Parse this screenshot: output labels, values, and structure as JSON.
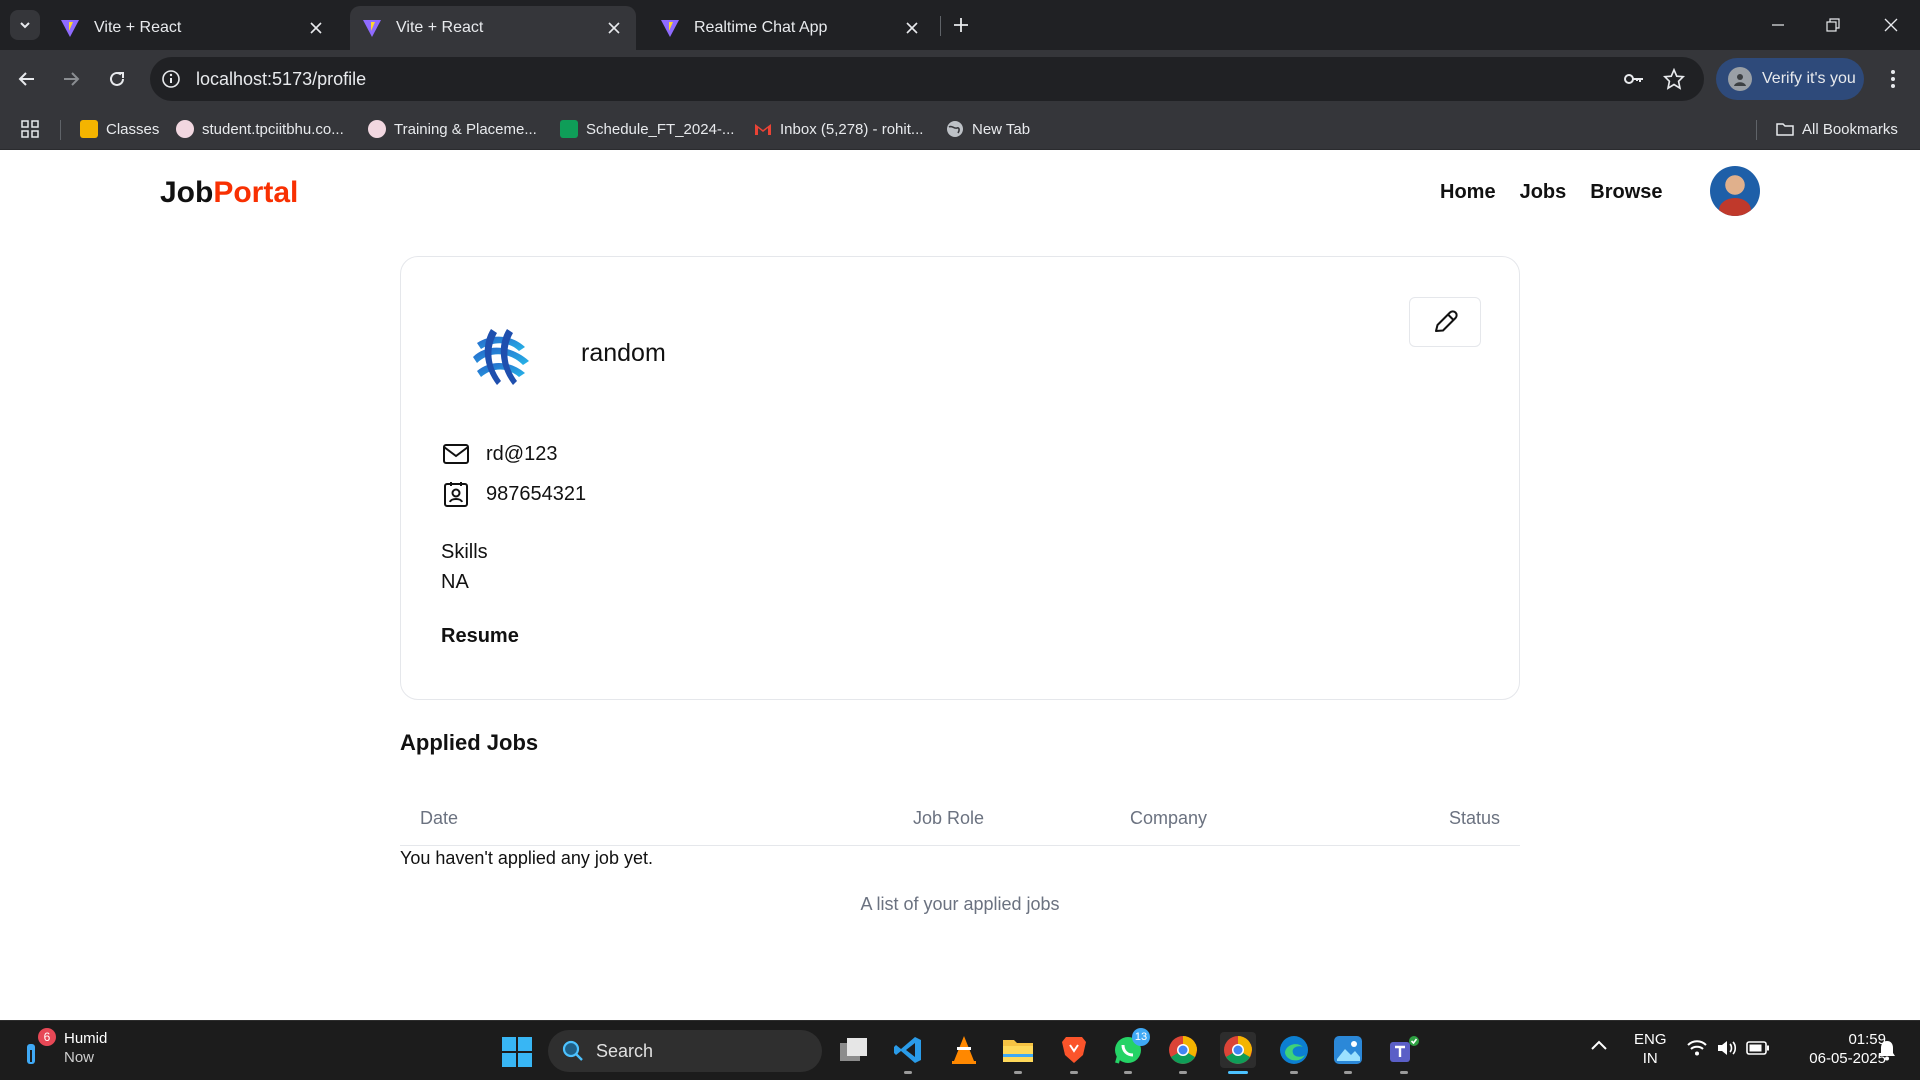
{
  "browser": {
    "tabs": [
      {
        "title": "Vite + React",
        "active": false
      },
      {
        "title": "Vite + React",
        "active": true
      },
      {
        "title": "Realtime Chat App",
        "active": false
      }
    ],
    "url": "localhost:5173/profile",
    "verify_label": "Verify it's you",
    "bookmarks": [
      {
        "label": "Classes"
      },
      {
        "label": "student.tpciitbhu.co..."
      },
      {
        "label": "Training & Placeme..."
      },
      {
        "label": "Schedule_FT_2024-..."
      },
      {
        "label": "Inbox (5,278) - rohit..."
      },
      {
        "label": "New Tab"
      }
    ],
    "all_bookmarks": "All Bookmarks"
  },
  "navbar": {
    "logo_primary": "Job",
    "logo_accent": "Portal",
    "links": [
      "Home",
      "Jobs",
      "Browse"
    ]
  },
  "profile": {
    "name": "random",
    "email": "rd@123",
    "phone": "987654321",
    "skills_label": "Skills",
    "skills_value": "NA",
    "resume_label": "Resume"
  },
  "applied_jobs": {
    "title": "Applied Jobs",
    "columns": [
      "Date",
      "Job Role",
      "Company",
      "Status"
    ],
    "empty_message": "You haven't applied any job yet.",
    "caption": "A list of your applied jobs"
  },
  "taskbar": {
    "weather_badge": "6",
    "weather_label": "Humid",
    "weather_sub": "Now",
    "search_placeholder": "Search",
    "whatsapp_badge": "13",
    "lang_top": "ENG",
    "lang_bottom": "IN",
    "time": "01:59",
    "date": "06-05-2025"
  },
  "colors": {
    "logo_accent": "#f83002",
    "chrome_dark": "#202124",
    "chrome_toolbar": "#35363a",
    "verify_button": "#2e4a7a",
    "taskbar": "#1c1c1c",
    "table_header_text": "#6b7280"
  }
}
